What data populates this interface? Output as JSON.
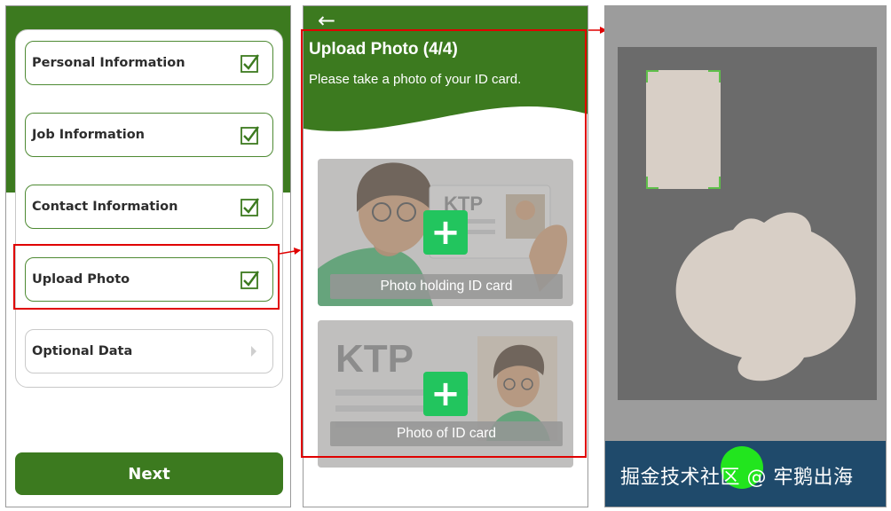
{
  "panel1": {
    "steps": [
      {
        "label": "Personal Information",
        "status": "completed"
      },
      {
        "label": "Job Information",
        "status": "completed"
      },
      {
        "label": "Contact Information",
        "status": "completed"
      },
      {
        "label": "Upload Photo",
        "status": "completed"
      },
      {
        "label": "Optional Data",
        "status": "pending"
      }
    ],
    "next_label": "Next"
  },
  "panel2": {
    "back_icon": "arrow-left-icon",
    "title": "Upload Photo (4/4)",
    "subtitle": "Please take a photo of your ID card.",
    "cards": [
      {
        "caption": "Photo holding ID card",
        "art_text": "KTP",
        "plus_icon": "plus-icon"
      },
      {
        "caption": "Photo of ID card",
        "art_text": "KTP",
        "plus_icon": "plus-icon"
      }
    ]
  },
  "panel3": {
    "watermark": "掘金技术社区 @ 牢鹅出海"
  },
  "colors": {
    "brand_green": "#3c7a1f",
    "plus_green": "#22c55e",
    "highlight_red": "#e00000",
    "shutter_green": "#22e51e",
    "camera_bar": "#1f4a6b"
  }
}
